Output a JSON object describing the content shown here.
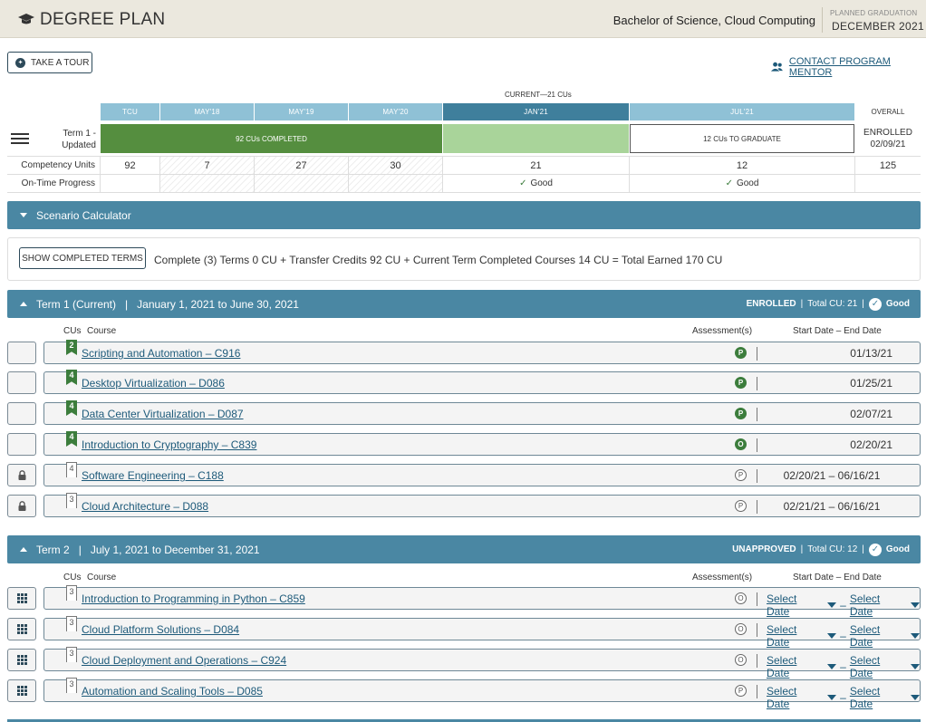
{
  "header": {
    "title": "DEGREE PLAN",
    "program": "Bachelor of Science, Cloud Computing",
    "planned_grad_label": "PLANNED GRADUATION",
    "planned_grad_value": "DECEMBER 2021"
  },
  "actions": {
    "tour": "TAKE A TOUR",
    "mentor": "CONTACT PROGRAM MENTOR"
  },
  "timeline": {
    "current_label": "CURRENT—21 CUs",
    "columns": [
      "TCU",
      "MAY'18",
      "MAY'19",
      "MAY'20",
      "JAN'21",
      "JUL'21"
    ],
    "overall_label": "OVERALL",
    "term_label_line1": "Term 1 -",
    "term_label_line2": "Updated",
    "completed_bar": "92 CUs COMPLETED",
    "to_graduate": "12 CUs TO GRADUATE",
    "overall_status_line1": "ENROLLED",
    "overall_status_line2": "02/09/21",
    "competency_label": "Competency Units",
    "competency_values": [
      "92",
      "7",
      "27",
      "30",
      "21",
      "12",
      "125"
    ],
    "progress_label": "On-Time Progress",
    "progress_values": [
      "Good",
      "Good"
    ],
    "colors": {
      "header_blue": "#8fc1d6",
      "current_blue": "#3f7f9c",
      "complete_green": "#558e3f",
      "current_green": "#a9d49a"
    }
  },
  "scenario": {
    "title": "Scenario Calculator",
    "show_button": "SHOW COMPLETED TERMS",
    "summary": "Complete (3) Terms 0 CU + Transfer Credits 92 CU + Current Term Completed Courses 14 CU = Total Earned 170 CU"
  },
  "term1": {
    "name": "Term 1 (Current)",
    "dates": "January 1, 2021 to June 30, 2021",
    "status": "ENROLLED",
    "total": "Total CU: 21",
    "progress": "Good",
    "col_cus": "CUs",
    "col_course": "Course",
    "col_assessment": "Assessment(s)",
    "col_dates": "Start Date – End Date",
    "courses": [
      {
        "cu": "2",
        "name": "Scripting and Automation – C916",
        "assess": "P",
        "date": "01/13/21"
      },
      {
        "cu": "4",
        "name": "Desktop Virtualization – D086",
        "assess": "P",
        "date": "01/25/21"
      },
      {
        "cu": "4",
        "name": "Data Center Virtualization – D087",
        "assess": "P",
        "date": "02/07/21"
      },
      {
        "cu": "4",
        "name": "Introduction to Cryptography – C839",
        "assess": "O",
        "date": "02/20/21"
      },
      {
        "cu": "4",
        "name": "Software Engineering – C188",
        "assess": "P",
        "date": "02/20/21 – 06/16/21"
      },
      {
        "cu": "3",
        "name": "Cloud Architecture – D088",
        "assess": "P",
        "date": "02/21/21 – 06/16/21"
      }
    ]
  },
  "term2": {
    "name": "Term 2",
    "dates": "July 1, 2021 to December 31, 2021",
    "status": "UNAPPROVED",
    "total": "Total CU: 12",
    "progress": "Good",
    "col_cus": "CUs",
    "col_course": "Course",
    "col_assessment": "Assessment(s)",
    "col_dates": "Start Date – End Date",
    "select_date": "Select Date",
    "dash": "–",
    "courses": [
      {
        "cu": "3",
        "name": "Introduction to Programming in Python – C859",
        "assess": "O"
      },
      {
        "cu": "3",
        "name": "Cloud Platform Solutions – D084",
        "assess": "O"
      },
      {
        "cu": "3",
        "name": "Cloud Deployment and Operations – C924",
        "assess": "O"
      },
      {
        "cu": "3",
        "name": "Automation and Scaling Tools – D085",
        "assess": "P"
      }
    ]
  }
}
